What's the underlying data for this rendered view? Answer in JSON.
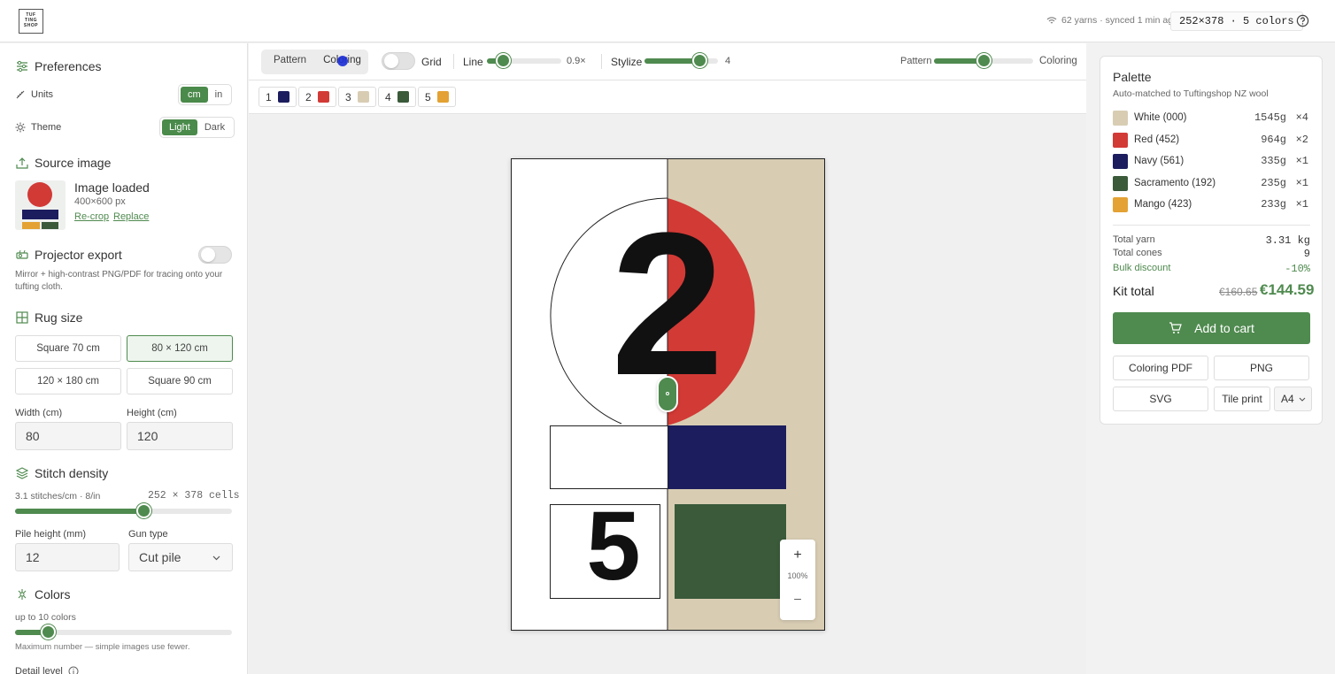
{
  "header": {
    "logo": "TUF TING SHOP",
    "status": "62 yarns · synced 1 min ago",
    "grid_info": "252×378 · 5 colors"
  },
  "sidebar": {
    "preferences": {
      "title": "Preferences",
      "units_label": "Units",
      "units_options": [
        "cm",
        "in"
      ],
      "units_selected": "cm",
      "theme_label": "Theme",
      "theme_options": [
        "Light",
        "Dark"
      ],
      "theme_selected": "Light"
    },
    "source": {
      "title": "Source image",
      "status": "Image loaded",
      "size": "400×600 px",
      "recrop": "Re-crop",
      "replace": "Replace"
    },
    "projector": {
      "title": "Projector export",
      "enabled": false,
      "description": "Mirror + high-contrast PNG/PDF for tracing onto your tufting cloth."
    },
    "rug": {
      "title": "Rug size",
      "presets": [
        "Square 70 cm",
        "80 × 120 cm",
        "120 × 180 cm",
        "Square 90 cm"
      ],
      "selected": "80 × 120 cm",
      "width_label": "Width (cm)",
      "width_value": "80",
      "height_label": "Height (cm)",
      "height_value": "120"
    },
    "stitch": {
      "title": "Stitch density",
      "density": "3.1 stitches/cm · 8/in",
      "cells": "252 × 378 cells",
      "slider_fraction": 0.59,
      "pile_label": "Pile height (mm)",
      "pile_value": "12",
      "gun_label": "Gun type",
      "gun_value": "Cut pile"
    },
    "colors": {
      "title": "Colors",
      "max_label": "up to 10 colors",
      "slider_fraction": 0.15,
      "hint": "Maximum number — simple images use fewer.",
      "detail_label": "Detail level"
    }
  },
  "toolbar": {
    "view_options": [
      "Pattern",
      "Coloring"
    ],
    "view_selected": "Coloring",
    "grid_label": "Grid",
    "grid_on": false,
    "line_label": "Line",
    "line_value": "0.9×",
    "line_fraction": 0.22,
    "stylize_label": "Stylize",
    "stylize_value": "4",
    "stylize_fraction": 0.75,
    "blend_left": "Pattern",
    "blend_right": "Coloring",
    "blend_fraction": 0.5,
    "chips": [
      {
        "num": "1",
        "color": "#1c1d5e"
      },
      {
        "num": "2",
        "color": "#d23a36"
      },
      {
        "num": "3",
        "color": "#d8cdb3"
      },
      {
        "num": "4",
        "color": "#3a5a3a"
      },
      {
        "num": "5",
        "color": "#e3a233"
      }
    ]
  },
  "canvas": {
    "number_a": "2",
    "number_b": "5",
    "zoom": "100%",
    "zoom_in": "+",
    "zoom_out": "–"
  },
  "palette": {
    "title": "Palette",
    "subtitle": "Auto-matched to Tuftingshop NZ wool",
    "items": [
      {
        "name": "White (000)",
        "grams": "1545g",
        "qty": "×4",
        "color": "#d8cdb3"
      },
      {
        "name": "Red (452)",
        "grams": "964g",
        "qty": "×2",
        "color": "#d23a36"
      },
      {
        "name": "Navy (561)",
        "grams": "335g",
        "qty": "×1",
        "color": "#1c1d5e"
      },
      {
        "name": "Sacramento (192)",
        "grams": "235g",
        "qty": "×1",
        "color": "#3a5a3a"
      },
      {
        "name": "Mango (423)",
        "grams": "233g",
        "qty": "×1",
        "color": "#e3a233"
      }
    ],
    "total_yarn_label": "Total yarn",
    "total_yarn": "3.31 kg",
    "total_cones_label": "Total cones",
    "total_cones": "9",
    "discount_label": "Bulk discount",
    "discount": "-10%",
    "kit_label": "Kit total",
    "old_price": "€160.65",
    "price": "€144.59",
    "cart": "Add to cart",
    "pdf": "Coloring PDF",
    "png": "PNG",
    "svg": "SVG",
    "tile": "Tile print",
    "paper": "A4"
  },
  "colors": {
    "accent": "#4f8a4f",
    "navy": "#1c1d5e",
    "red": "#d23a36",
    "cream": "#d8cdb3",
    "green": "#3a5a3a",
    "mango": "#e3a233"
  }
}
